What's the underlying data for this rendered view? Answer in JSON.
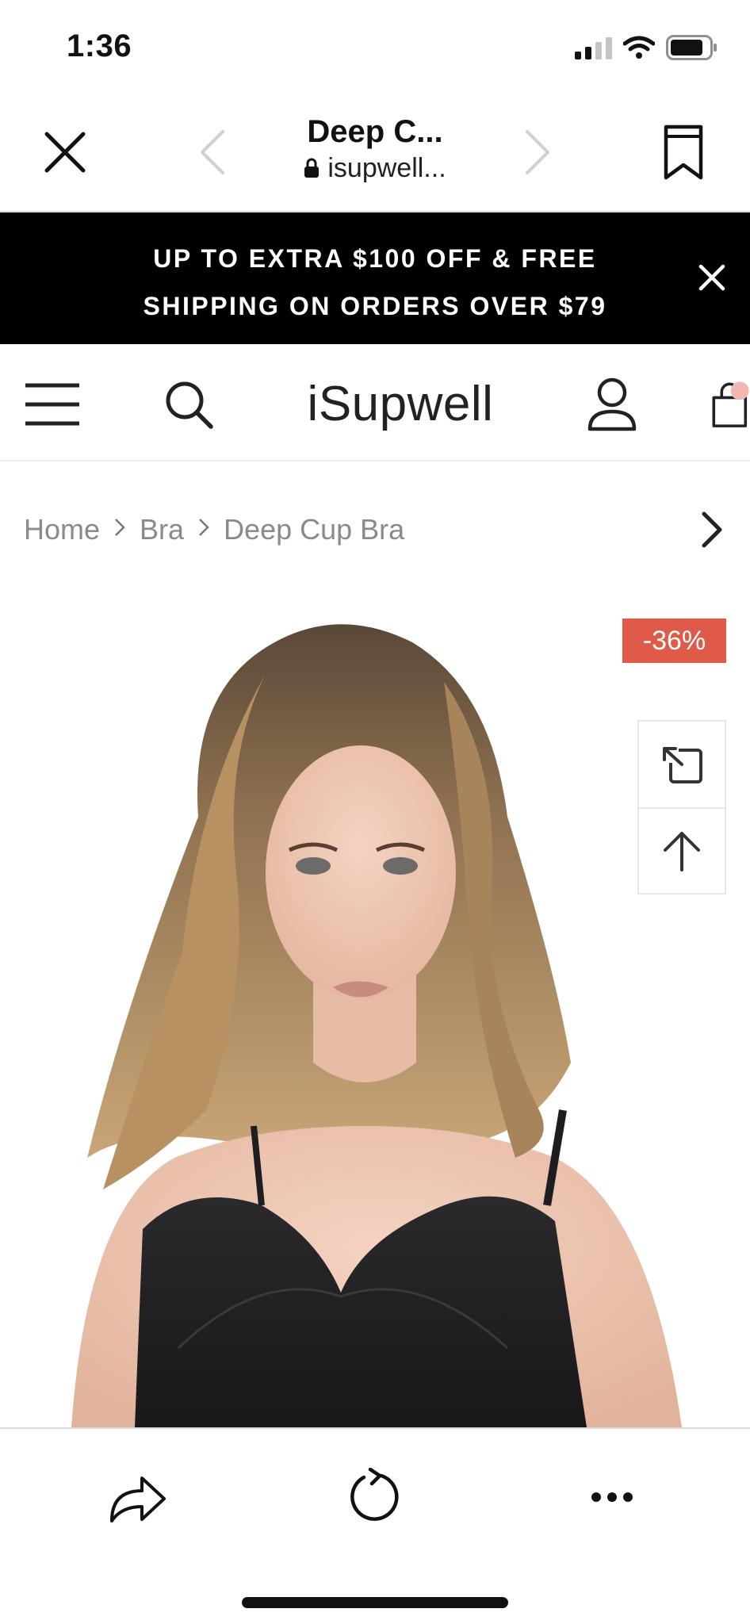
{
  "status_bar": {
    "time": "1:36"
  },
  "browser": {
    "title": "Deep C...",
    "url": "isupwell...",
    "icons": {
      "close": "close-icon",
      "back": "chevron-left-icon",
      "forward": "chevron-right-icon",
      "bookmark": "bookmark-icon",
      "lock": "lock-icon"
    }
  },
  "promo": {
    "line1": "UP TO EXTRA $100 OFF & FREE",
    "line2": "SHIPPING ON ORDERS OVER $79"
  },
  "site_header": {
    "logo": "iSupwell",
    "icons": [
      "menu-icon",
      "search-icon",
      "account-icon",
      "cart-icon"
    ]
  },
  "breadcrumb": {
    "items": [
      "Home",
      "Bra",
      "Deep Cup Bra"
    ],
    "separator": ">"
  },
  "product": {
    "discount_badge": "-36%",
    "badge_color": "#e05a4a",
    "tools": [
      "expand-icon",
      "arrow-up-icon"
    ]
  },
  "bottom_toolbar": {
    "icons": [
      "share-icon",
      "reload-icon",
      "more-icon"
    ]
  }
}
